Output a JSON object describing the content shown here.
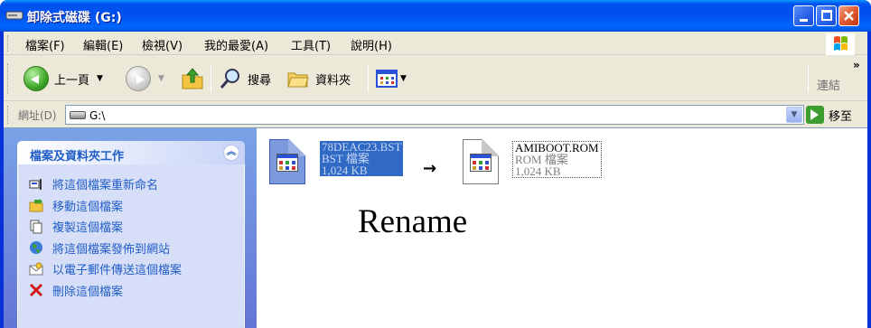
{
  "window": {
    "title": "卸除式磁碟 (G:)"
  },
  "menubar": {
    "items": [
      "檔案(F)",
      "編輯(E)",
      "檢視(V)",
      "我的最愛(A)",
      "工具(T)",
      "說明(H)"
    ]
  },
  "toolbar": {
    "back_label": "上一頁",
    "search_label": "搜尋",
    "folders_label": "資料夾",
    "links_label": "連結"
  },
  "address": {
    "label": "網址(D)",
    "value": "G:\\",
    "go_label": "移至"
  },
  "tasks": {
    "title": "檔案及資料夾工作",
    "items": [
      {
        "label": "將這個檔案重新命名",
        "icon": "rename-icon"
      },
      {
        "label": "移動這個檔案",
        "icon": "move-icon"
      },
      {
        "label": "複製這個檔案",
        "icon": "copy-icon"
      },
      {
        "label": "將這個檔案發佈到網站",
        "icon": "publish-web-icon"
      },
      {
        "label": "以電子郵件傳送這個檔案",
        "icon": "email-icon"
      },
      {
        "label": "刪除這個檔案",
        "icon": "delete-icon"
      }
    ]
  },
  "files": [
    {
      "name": "78DEAC23.BST",
      "type": "BST 檔案",
      "size": "1,024 KB",
      "selected": true
    },
    {
      "name": "AMIBOOT.ROM",
      "type": "ROM 檔案",
      "size": "1,024 KB",
      "selected": false
    }
  ],
  "annotation": {
    "arrow": "→",
    "text": "Rename"
  },
  "colors": {
    "titlebar": "#0054e3",
    "task_text": "#215dc6",
    "selection": "#316ac5"
  }
}
